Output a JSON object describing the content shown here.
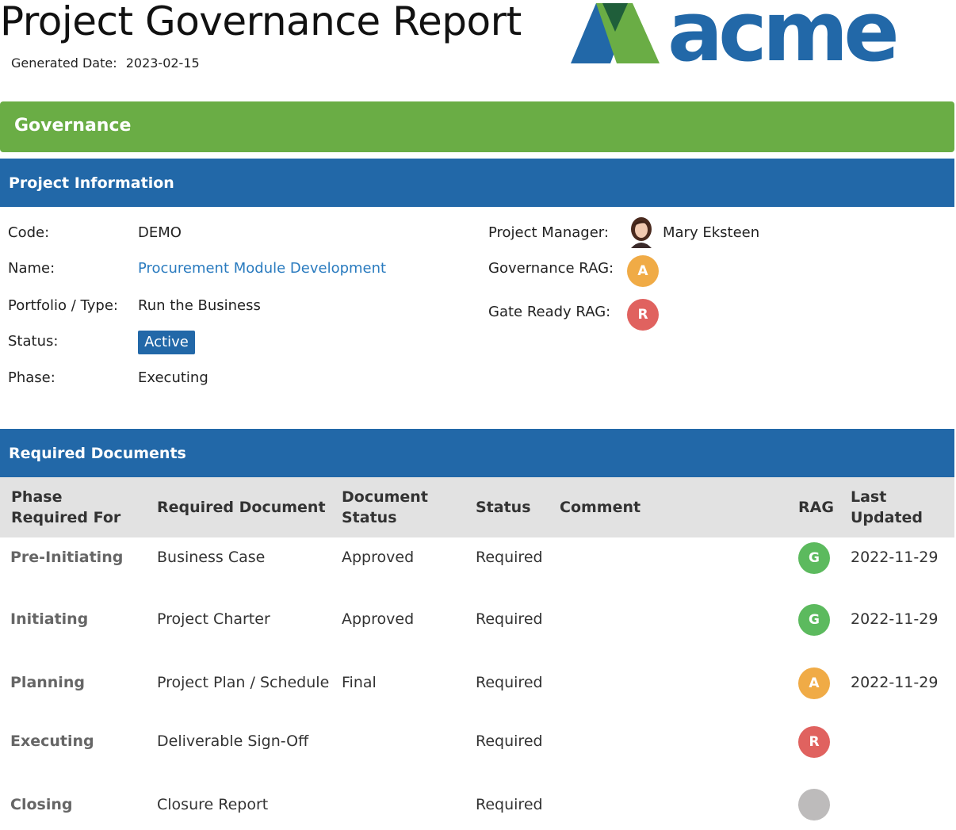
{
  "header": {
    "title": "Project Governance Report",
    "generated_label": "Generated Date:",
    "generated_value": "2023-02-15",
    "logo_text": "acme",
    "logo_colors": {
      "blue": "#2268a8",
      "green": "#6aad45",
      "dark_green": "#1f5e3a"
    }
  },
  "sections": {
    "governance": "Governance",
    "project_information": "Project Information",
    "required_documents": "Required Documents"
  },
  "project": {
    "code_label": "Code:",
    "code": "DEMO",
    "name_label": "Name:",
    "name": "Procurement Module Development",
    "portfolio_label": "Portfolio / Type:",
    "portfolio": "Run the Business",
    "status_label": "Status:",
    "status": "Active",
    "phase_label": "Phase:",
    "phase": "Executing",
    "manager_label": "Project Manager:",
    "manager": "Mary Eksteen",
    "governance_rag_label": "Governance RAG:",
    "governance_rag": "A",
    "gate_ready_rag_label": "Gate Ready RAG:",
    "gate_ready_rag": "R"
  },
  "table": {
    "columns": [
      "Phase Required For",
      "Required Document",
      "Document Status",
      "Status",
      "Comment",
      "RAG",
      "Last Updated"
    ],
    "rows": [
      {
        "phase": "Pre-Initiating",
        "document": "Business Case",
        "doc_status": "Approved",
        "status": "Required",
        "comment": "",
        "rag": "G",
        "updated": "2022-11-29"
      },
      {
        "phase": "Initiating",
        "document": "Project Charter",
        "doc_status": "Approved",
        "status": "Required",
        "comment": "",
        "rag": "G",
        "updated": "2022-11-29"
      },
      {
        "phase": "Planning",
        "document": "Project Plan / Schedule",
        "doc_status": "Final",
        "status": "Required",
        "comment": "",
        "rag": "A",
        "updated": "2022-11-29"
      },
      {
        "phase": "Executing",
        "document": "Deliverable Sign-Off",
        "doc_status": "",
        "status": "Required",
        "comment": "",
        "rag": "R",
        "updated": ""
      },
      {
        "phase": "Closing",
        "document": "Closure Report",
        "doc_status": "",
        "status": "Required",
        "comment": "",
        "rag": "",
        "updated": ""
      }
    ]
  },
  "rag_colors": {
    "G": "#5cba5e",
    "A": "#f0ab46",
    "R": "#e0625f",
    "none": "#bdbbbb"
  }
}
